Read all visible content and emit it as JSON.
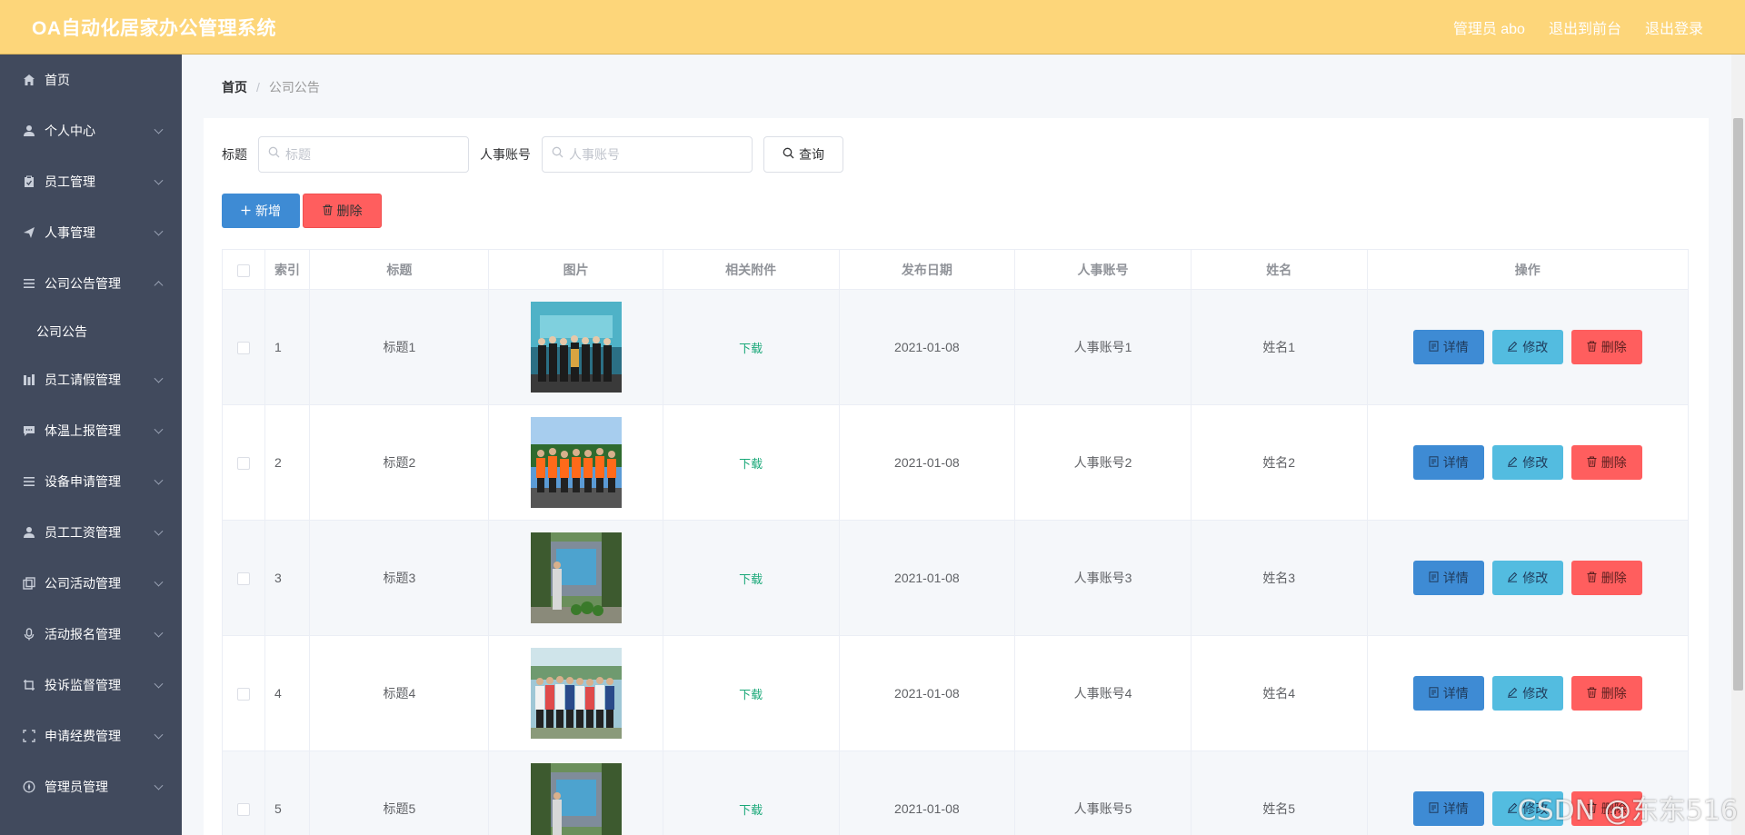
{
  "header": {
    "title": "OA自动化居家办公管理系统",
    "user_label": "管理员 abo",
    "front_link": "退出到前台",
    "logout_link": "退出登录"
  },
  "sidebar": {
    "items": [
      {
        "label": "首页",
        "icon": "home-icon"
      },
      {
        "label": "个人中心",
        "icon": "user-icon"
      },
      {
        "label": "员工管理",
        "icon": "clipboard-icon"
      },
      {
        "label": "人事管理",
        "icon": "send-icon"
      },
      {
        "label": "公司公告管理",
        "icon": "list-icon",
        "expanded": true
      },
      {
        "label": "公司公告",
        "sub": true
      },
      {
        "label": "员工请假管理",
        "icon": "chart-icon"
      },
      {
        "label": "体温上报管理",
        "icon": "chat-icon"
      },
      {
        "label": "设备申请管理",
        "icon": "list-icon"
      },
      {
        "label": "员工工资管理",
        "icon": "user-icon"
      },
      {
        "label": "公司活动管理",
        "icon": "copy-icon"
      },
      {
        "label": "活动报名管理",
        "icon": "mic-icon"
      },
      {
        "label": "投诉监督管理",
        "icon": "crop-icon"
      },
      {
        "label": "申请经费管理",
        "icon": "fullscreen-icon"
      },
      {
        "label": "管理员管理",
        "icon": "compass-icon"
      }
    ]
  },
  "breadcrumb": {
    "home": "首页",
    "separator": "/",
    "current": "公司公告"
  },
  "search": {
    "title_label": "标题",
    "title_placeholder": "标题",
    "account_label": "人事账号",
    "account_placeholder": "人事账号",
    "query_button": "查询"
  },
  "actions": {
    "add_button": "新增",
    "delete_button": "删除"
  },
  "table": {
    "columns": [
      "索引",
      "标题",
      "图片",
      "相关附件",
      "发布日期",
      "人事账号",
      "姓名",
      "操作"
    ],
    "download_label": "下载",
    "detail_button": "详情",
    "edit_button": "修改",
    "delete_button": "删除",
    "rows": [
      {
        "index": "1",
        "title": "标题1",
        "date": "2021-01-08",
        "account": "人事账号1",
        "name": "姓名1"
      },
      {
        "index": "2",
        "title": "标题2",
        "date": "2021-01-08",
        "account": "人事账号2",
        "name": "姓名2"
      },
      {
        "index": "3",
        "title": "标题3",
        "date": "2021-01-08",
        "account": "人事账号3",
        "name": "姓名3"
      },
      {
        "index": "4",
        "title": "标题4",
        "date": "2021-01-08",
        "account": "人事账号4",
        "name": "姓名4"
      },
      {
        "index": "5",
        "title": "标题5",
        "date": "2021-01-08",
        "account": "人事账号5",
        "name": "姓名5"
      }
    ]
  },
  "watermark": "CSDN @东东516",
  "colors": {
    "header_bg": "#fdd67a",
    "sidebar_bg": "#414a5d",
    "primary": "#3e8bd4",
    "info": "#53bce0",
    "danger": "#ff5e5e",
    "link": "#19a878"
  }
}
